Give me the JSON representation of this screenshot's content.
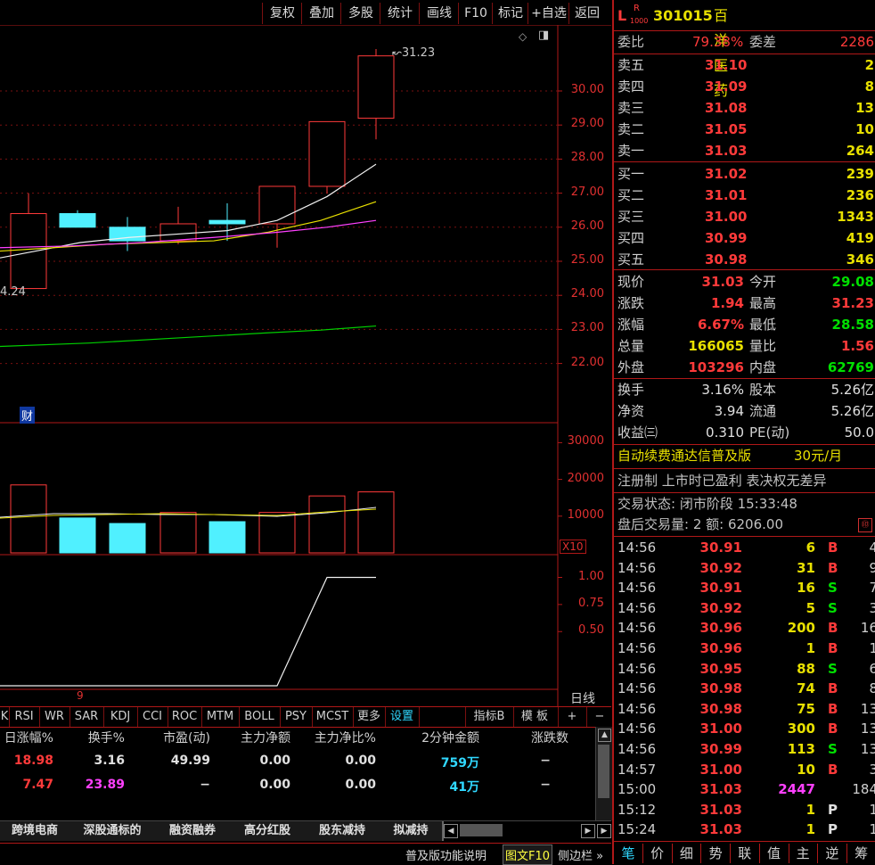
{
  "toolbar": [
    "复权",
    "叠加",
    "多股",
    "统计",
    "画线",
    "F10",
    "标记",
    "+自选",
    "返回"
  ],
  "stock": {
    "marker_l": "L",
    "marker_r": "R",
    "marker_sub": "1000",
    "code": "301015",
    "name": "百洋医药"
  },
  "ratio": {
    "label": "委比",
    "value": "79.38%",
    "diff_label": "委差",
    "diff": "2286"
  },
  "asks": [
    {
      "label": "卖五",
      "price": "31.10",
      "vol": "2"
    },
    {
      "label": "卖四",
      "price": "31.09",
      "vol": "8"
    },
    {
      "label": "卖三",
      "price": "31.08",
      "vol": "13"
    },
    {
      "label": "卖二",
      "price": "31.05",
      "vol": "10"
    },
    {
      "label": "卖一",
      "price": "31.03",
      "vol": "264"
    }
  ],
  "bids": [
    {
      "label": "买一",
      "price": "31.02",
      "vol": "239"
    },
    {
      "label": "买二",
      "price": "31.01",
      "vol": "236"
    },
    {
      "label": "买三",
      "price": "31.00",
      "vol": "1343"
    },
    {
      "label": "买四",
      "price": "30.99",
      "vol": "419"
    },
    {
      "label": "买五",
      "price": "30.98",
      "vol": "346"
    }
  ],
  "quote": [
    {
      "l1": "现价",
      "v1": "31.03",
      "c1": "red",
      "l2": "今开",
      "v2": "29.08",
      "c2": "green"
    },
    {
      "l1": "涨跌",
      "v1": "1.94",
      "c1": "red",
      "l2": "最高",
      "v2": "31.23",
      "c2": "red"
    },
    {
      "l1": "涨幅",
      "v1": "6.67%",
      "c1": "red",
      "l2": "最低",
      "v2": "28.58",
      "c2": "green"
    },
    {
      "l1": "总量",
      "v1": "166065",
      "c1": "yellow",
      "l2": "量比",
      "v2": "1.56",
      "c2": "red"
    },
    {
      "l1": "外盘",
      "v1": "103296",
      "c1": "red",
      "l2": "内盘",
      "v2": "62769",
      "c2": "green"
    }
  ],
  "stats": [
    {
      "l1": "换手",
      "v1": "3.16%",
      "l2": "股本",
      "v2": "5.26亿"
    },
    {
      "l1": "净资",
      "v1": "3.94",
      "l2": "流通",
      "v2": "5.26亿"
    },
    {
      "l1": "收益㈢",
      "v1": "0.310",
      "l2": "PE(动)",
      "v2": "50.0"
    }
  ],
  "promo": {
    "text": "自动续费通达信普及版",
    "price": "30元/月"
  },
  "info_line": "注册制 上市时已盈利 表决权无差异",
  "trade_status": "交易状态: 闭市阶段 15:33:48",
  "after_hours": "盘后交易量: 2  额: 6206.00",
  "ticks": [
    {
      "t": "14:56",
      "p": "30.91",
      "v": "6",
      "s": "B",
      "n": "4",
      "pc": "red",
      "vc": "yellow"
    },
    {
      "t": "14:56",
      "p": "30.92",
      "v": "31",
      "s": "B",
      "n": "9",
      "pc": "red",
      "vc": "yellow"
    },
    {
      "t": "14:56",
      "p": "30.91",
      "v": "16",
      "s": "S",
      "n": "7",
      "pc": "red",
      "vc": "yellow"
    },
    {
      "t": "14:56",
      "p": "30.92",
      "v": "5",
      "s": "S",
      "n": "3",
      "pc": "red",
      "vc": "yellow"
    },
    {
      "t": "14:56",
      "p": "30.96",
      "v": "200",
      "s": "B",
      "n": "16",
      "pc": "red",
      "vc": "yellow"
    },
    {
      "t": "14:56",
      "p": "30.96",
      "v": "1",
      "s": "B",
      "n": "1",
      "pc": "red",
      "vc": "yellow"
    },
    {
      "t": "14:56",
      "p": "30.95",
      "v": "88",
      "s": "S",
      "n": "6",
      "pc": "red",
      "vc": "yellow"
    },
    {
      "t": "14:56",
      "p": "30.98",
      "v": "74",
      "s": "B",
      "n": "8",
      "pc": "red",
      "vc": "yellow"
    },
    {
      "t": "14:56",
      "p": "30.98",
      "v": "75",
      "s": "B",
      "n": "13",
      "pc": "red",
      "vc": "yellow"
    },
    {
      "t": "14:56",
      "p": "31.00",
      "v": "300",
      "s": "B",
      "n": "13",
      "pc": "red",
      "vc": "yellow"
    },
    {
      "t": "14:56",
      "p": "30.99",
      "v": "113",
      "s": "S",
      "n": "13",
      "pc": "red",
      "vc": "yellow"
    },
    {
      "t": "14:57",
      "p": "31.00",
      "v": "10",
      "s": "B",
      "n": "3",
      "pc": "red",
      "vc": "yellow"
    },
    {
      "t": "15:00",
      "p": "31.03",
      "v": "2447",
      "s": "",
      "n": "184",
      "pc": "red",
      "vc": "magenta"
    },
    {
      "t": "15:12",
      "p": "31.03",
      "v": "1",
      "s": "P",
      "n": "1",
      "pc": "red",
      "vc": "yellow"
    },
    {
      "t": "15:24",
      "p": "31.03",
      "v": "1",
      "s": "P",
      "n": "1",
      "pc": "red",
      "vc": "yellow"
    }
  ],
  "right_tabs": [
    "笔",
    "价",
    "细",
    "势",
    "联",
    "值",
    "主",
    "逆",
    "筹"
  ],
  "chart": {
    "price_ticks": [
      "30.00",
      "29.00",
      "28.00",
      "27.00",
      "26.00",
      "25.00",
      "24.00",
      "23.00",
      "22.00"
    ],
    "high_label": "31.23",
    "low_label": "4.24",
    "cai_label": "财",
    "vol_ticks": [
      "30000",
      "20000",
      "10000"
    ],
    "vol_unit": "X10",
    "ind_ticks": [
      "1.00",
      "0.75",
      "0.50"
    ],
    "period": "日线",
    "axis_label": "9"
  },
  "chart_data": {
    "type": "candlestick",
    "candles": [
      {
        "open": 24.2,
        "close": 26.4,
        "high": 27.0,
        "low": 24.2,
        "up": true
      },
      {
        "open": 26.4,
        "close": 26.0,
        "high": 26.5,
        "low": 26.0,
        "up": false
      },
      {
        "open": 26.0,
        "close": 25.6,
        "high": 26.3,
        "low": 25.3,
        "up": false
      },
      {
        "open": 25.6,
        "close": 26.1,
        "high": 26.6,
        "low": 25.5,
        "up": true
      },
      {
        "open": 26.2,
        "close": 26.1,
        "high": 26.7,
        "low": 25.6,
        "up": false
      },
      {
        "open": 26.1,
        "close": 27.2,
        "high": 27.2,
        "low": 25.4,
        "up": true
      },
      {
        "open": 27.2,
        "close": 29.1,
        "high": 29.1,
        "low": 27.0,
        "up": true
      },
      {
        "open": 29.2,
        "close": 31.03,
        "high": 31.23,
        "low": 28.58,
        "up": true
      }
    ],
    "volumes": [
      18500,
      9500,
      8000,
      11000,
      8500,
      11000,
      15500,
      16606
    ],
    "indicator": [
      0,
      0,
      0,
      0,
      0,
      0,
      1,
      1
    ]
  },
  "indicator_tabs": [
    "K",
    "RSI",
    "WR",
    "SAR",
    "KDJ",
    "CCI",
    "ROC",
    "MTM",
    "BOLL",
    "PSY",
    "MCST",
    "更多",
    "设置"
  ],
  "indicator_tabs_right": [
    "指标B",
    "模 板",
    "+",
    "−"
  ],
  "table": {
    "headers": [
      "日涨幅%",
      "换手%",
      "市盈(动)",
      "主力净额",
      "主力净比%",
      "2分钟金额",
      "涨跌数"
    ],
    "rows": [
      [
        "18.98",
        "3.16",
        "49.99",
        "0.00",
        "0.00",
        "759万",
        "−"
      ],
      [
        "7.47",
        "23.89",
        "−",
        "0.00",
        "0.00",
        "41万",
        "−"
      ]
    ]
  },
  "bottom_tabs": [
    "跨境电商",
    "深股通标的",
    "融资融券",
    "高分红股",
    "股东减持",
    "拟减持"
  ],
  "status_bar": {
    "help": "普及版功能说明",
    "graphic": "图文F10",
    "sidebar": "侧边栏 »"
  }
}
